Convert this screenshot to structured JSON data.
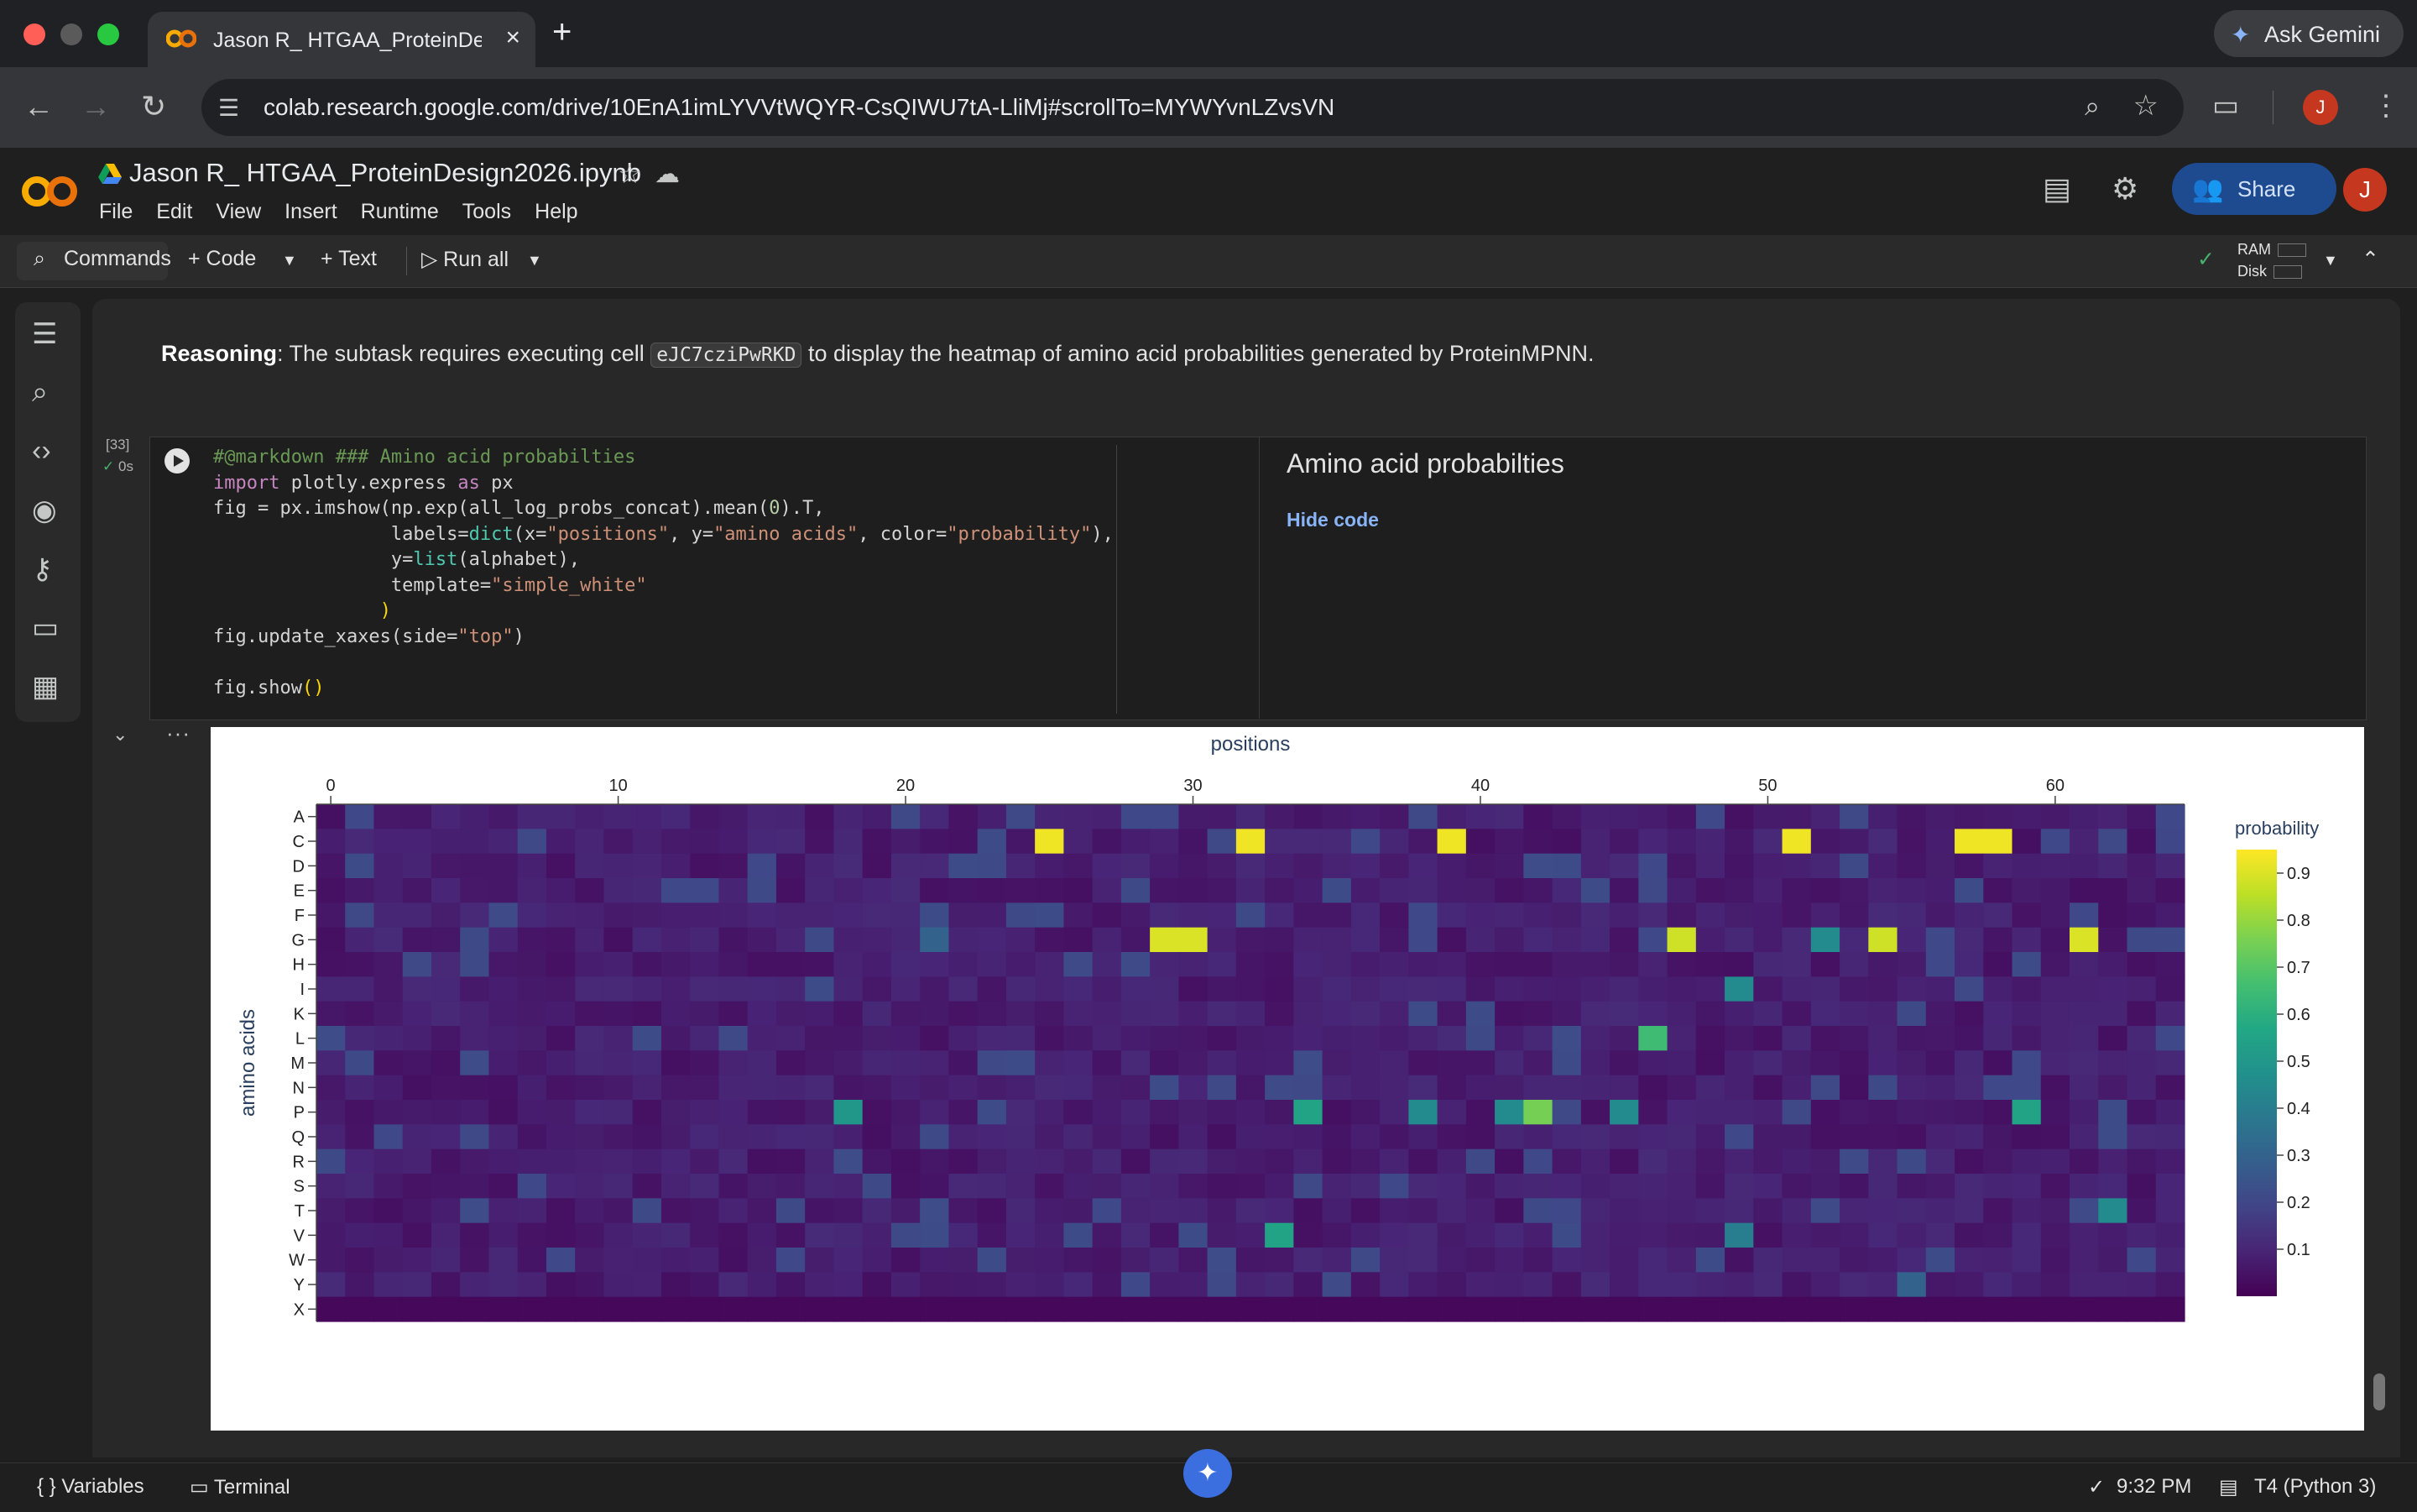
{
  "browser": {
    "tab_title": "Jason R_ HTGAA_ProteinDesi",
    "new_tab_symbol": "+",
    "ask_gemini": "Ask Gemini",
    "url": "colab.research.google.com/drive/10EnA1imLYVVtWQYR-CsQIWU7tA-LliMj#scrollTo=MYWYvnLZvsVN",
    "profile_initial": "J"
  },
  "colab": {
    "notebook_title": "Jason R_ HTGAA_ProteinDesign2026.ipynb",
    "menu": [
      "File",
      "Edit",
      "View",
      "Insert",
      "Runtime",
      "Tools",
      "Help"
    ],
    "share_label": "Share",
    "avatar_initial": "J"
  },
  "toolbar": {
    "commands": "Commands",
    "code": "Code",
    "text": "Text",
    "run_all": "Run all",
    "ram": "RAM",
    "disk": "Disk"
  },
  "reasoning": {
    "label": "Reasoning",
    "text_before": ": The subtask requires executing cell ",
    "cell_id": "eJC7cziPwRKD",
    "text_after": " to display the heatmap of amino acid probabilities generated by ProteinMPNN."
  },
  "cell": {
    "exec_count": "[33]",
    "exec_time": "0s",
    "form_title": "Amino acid probabilties",
    "hide_code": "Hide code",
    "code_lines": [
      "#@markdown ### Amino acid probabilties",
      "import plotly.express as px",
      "fig = px.imshow(np.exp(all_log_probs_concat).mean(0).T,",
      "                labels=dict(x=\"positions\", y=\"amino acids\", color=\"probability\"),",
      "                y=list(alphabet),",
      "                template=\"simple_white\"",
      "               )",
      "fig.update_xaxes(side=\"top\")",
      "",
      "fig.show()"
    ]
  },
  "chart_data": {
    "type": "heatmap",
    "title": "",
    "xlabel": "positions",
    "ylabel": "amino acids",
    "colorbar_title": "probability",
    "colorscale": "viridis",
    "x_ticks": [
      0,
      10,
      20,
      30,
      40,
      50,
      60
    ],
    "x_range": [
      0,
      64
    ],
    "y_categories": [
      "A",
      "C",
      "D",
      "E",
      "F",
      "G",
      "H",
      "I",
      "K",
      "L",
      "M",
      "N",
      "P",
      "Q",
      "R",
      "S",
      "T",
      "V",
      "W",
      "Y",
      "X"
    ],
    "colorbar_ticks": [
      0.1,
      0.2,
      0.3,
      0.4,
      0.5,
      0.6,
      0.7,
      0.8,
      0.9
    ],
    "zlim": [
      0.0,
      0.95
    ],
    "baseline_probability": 0.04,
    "highlighted_cells": [
      {
        "x": 25,
        "y": "C",
        "p": 0.93
      },
      {
        "x": 32,
        "y": "C",
        "p": 0.93
      },
      {
        "x": 39,
        "y": "C",
        "p": 0.93
      },
      {
        "x": 51,
        "y": "C",
        "p": 0.93
      },
      {
        "x": 57,
        "y": "C",
        "p": 0.93
      },
      {
        "x": 58,
        "y": "C",
        "p": 0.93
      },
      {
        "x": 29,
        "y": "G",
        "p": 0.9
      },
      {
        "x": 30,
        "y": "G",
        "p": 0.9
      },
      {
        "x": 47,
        "y": "G",
        "p": 0.88
      },
      {
        "x": 52,
        "y": "G",
        "p": 0.45
      },
      {
        "x": 54,
        "y": "G",
        "p": 0.88
      },
      {
        "x": 61,
        "y": "G",
        "p": 0.9
      },
      {
        "x": 21,
        "y": "G",
        "p": 0.3
      },
      {
        "x": 49,
        "y": "I",
        "p": 0.45
      },
      {
        "x": 46,
        "y": "L",
        "p": 0.65
      },
      {
        "x": 18,
        "y": "P",
        "p": 0.5
      },
      {
        "x": 34,
        "y": "P",
        "p": 0.55
      },
      {
        "x": 38,
        "y": "P",
        "p": 0.45
      },
      {
        "x": 41,
        "y": "P",
        "p": 0.45
      },
      {
        "x": 42,
        "y": "P",
        "p": 0.75
      },
      {
        "x": 45,
        "y": "P",
        "p": 0.45
      },
      {
        "x": 59,
        "y": "P",
        "p": 0.55
      },
      {
        "x": 33,
        "y": "V",
        "p": 0.55
      },
      {
        "x": 49,
        "y": "V",
        "p": 0.4
      },
      {
        "x": 62,
        "y": "T",
        "p": 0.45
      },
      {
        "x": 55,
        "y": "Y",
        "p": 0.3
      }
    ]
  },
  "status": {
    "variables": "Variables",
    "terminal": "Terminal",
    "time": "9:32 PM",
    "runtime": "T4 (Python 3)"
  }
}
